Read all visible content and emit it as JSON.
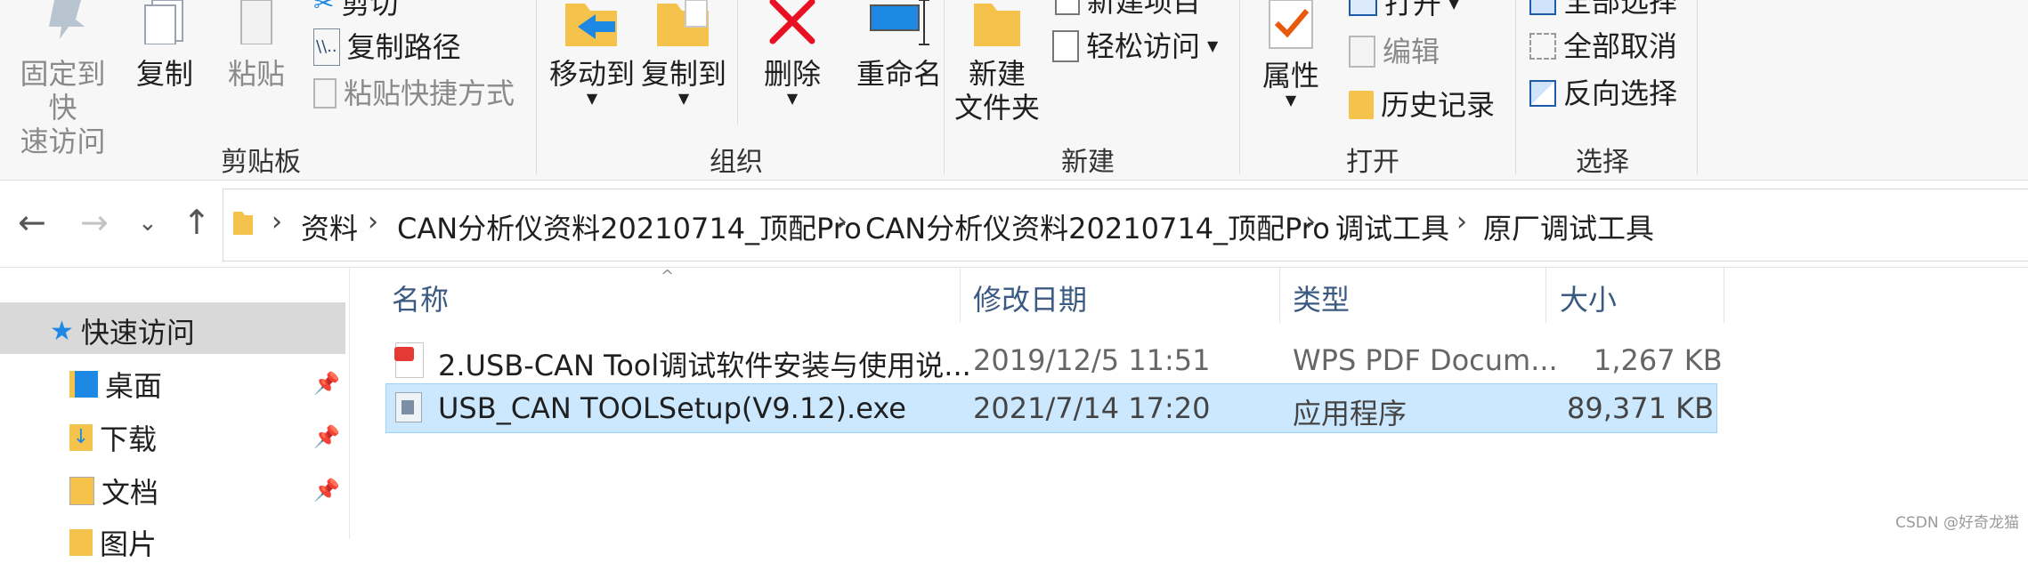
{
  "ribbon": {
    "clipboard": {
      "pin_label_1": "固定到快",
      "pin_label_2": "速访问",
      "copy_label": "复制",
      "paste_label": "粘贴",
      "cut_label": "剪切",
      "copy_path_label": "复制路径",
      "paste_shortcut_label": "粘贴快捷方式",
      "group_label": "剪贴板"
    },
    "organize": {
      "move_to_label": "移动到",
      "copy_to_label": "复制到",
      "delete_label": "删除",
      "rename_label": "重命名",
      "group_label": "组织"
    },
    "new": {
      "new_folder_1": "新建",
      "new_folder_2": "文件夹",
      "new_item_label": "新建项目",
      "easy_access_label": "轻松访问",
      "group_label": "新建"
    },
    "open": {
      "properties_label": "属性",
      "open_label": "打开",
      "edit_label": "编辑",
      "history_label": "历史记录",
      "group_label": "打开"
    },
    "select": {
      "select_all_label": "全部选择",
      "select_none_label": "全部取消",
      "invert_label": "反向选择",
      "group_label": "选择"
    }
  },
  "address": {
    "crumbs": [
      "资料",
      "CAN分析仪资料20210714_顶配Pro",
      "CAN分析仪资料20210714_顶配Pro",
      "调试工具",
      "原厂调试工具"
    ]
  },
  "nav": {
    "quick_access": "快速访问",
    "items": [
      "桌面",
      "下载",
      "文档",
      "图片"
    ]
  },
  "columns": {
    "name": "名称",
    "modified": "修改日期",
    "type": "类型",
    "size": "大小"
  },
  "files": [
    {
      "name": "2.USB-CAN Tool调试软件安装与使用说...",
      "modified": "2019/12/5 11:51",
      "type": "WPS PDF Docum...",
      "size": "1,267 KB"
    },
    {
      "name": "USB_CAN TOOLSetup(V9.12).exe",
      "modified": "2021/7/14 17:20",
      "type": "应用程序",
      "size": "89,371 KB"
    }
  ],
  "watermark": "CSDN @好奇龙猫",
  "colors": {
    "selection": "#cce8ff",
    "selection_border": "#99d1ff",
    "delete_red": "#e81123",
    "folder_yellow": "#f5c24c",
    "accent_blue": "#1e88e5"
  }
}
